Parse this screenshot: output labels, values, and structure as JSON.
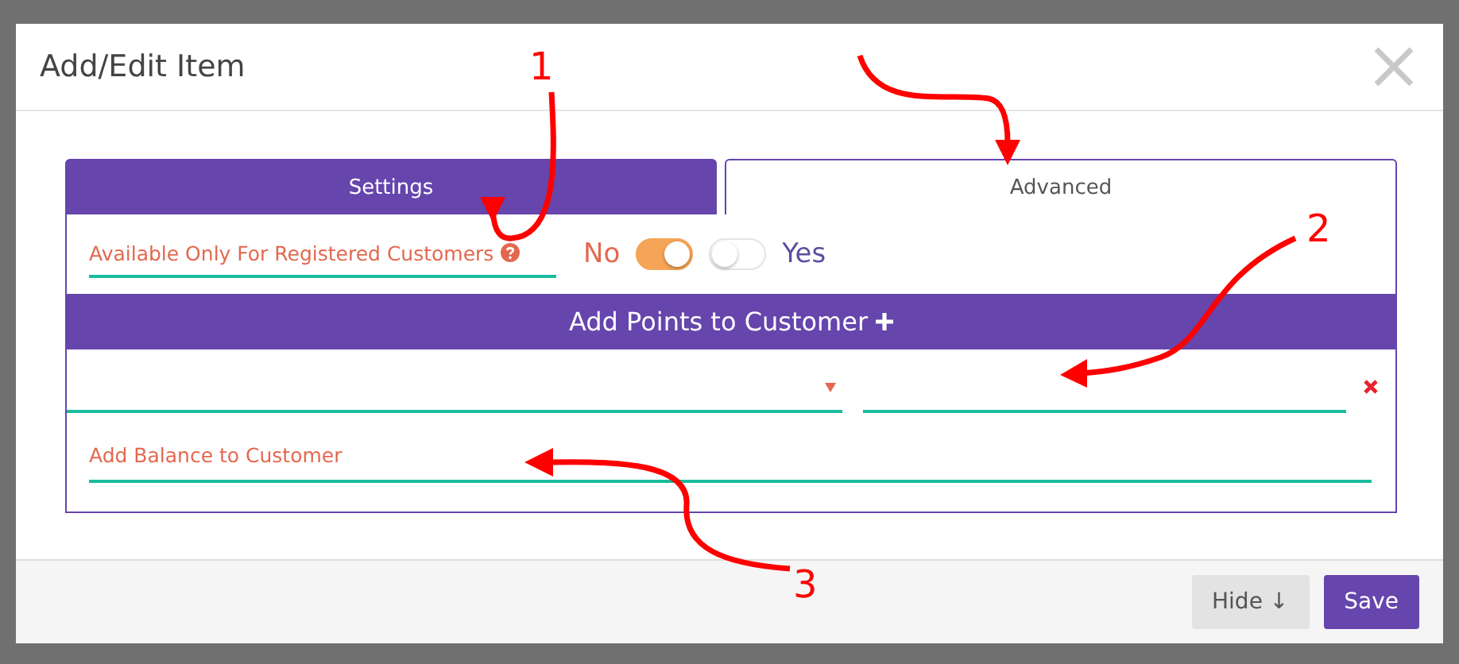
{
  "dialog": {
    "title": "Add/Edit Item"
  },
  "tabs": [
    {
      "label": "Settings",
      "selected": true
    },
    {
      "label": "Advanced",
      "selected": false
    }
  ],
  "registered_field": {
    "label": "Available Only For Registered Customers"
  },
  "switch": {
    "off_label": "No",
    "on_label": "Yes",
    "toggles": [
      {
        "on": true
      },
      {
        "on": false
      }
    ]
  },
  "points_bar": {
    "label": "Add Points to Customer"
  },
  "balance_field": {
    "placeholder": "Add Balance to Customer"
  },
  "buttons": [
    {
      "label": "Hide ↓",
      "kind": "secondary"
    },
    {
      "label": "Save",
      "kind": "primary"
    }
  ],
  "annotations": [
    {
      "label": "1"
    },
    {
      "label": "2"
    },
    {
      "label": "3"
    }
  ]
}
